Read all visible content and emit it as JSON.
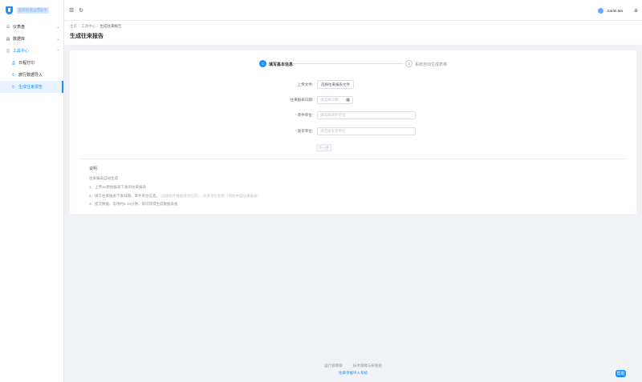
{
  "brand": {
    "name": "医院智能运营助手",
    "accent": "#1890ff"
  },
  "sidebar": {
    "items": [
      {
        "label": "仪表盘",
        "icon": "dashboard-icon"
      },
      {
        "label": "数据库",
        "icon": "database-icon"
      },
      {
        "label": "工具中心",
        "icon": "toolbox-icon",
        "expanded": true
      }
    ],
    "subitems": [
      {
        "label": "日程打印",
        "icon": "print-icon"
      },
      {
        "label": "旅行数据导入",
        "icon": "refresh-icon"
      },
      {
        "label": "生成往来报告",
        "icon": "refresh-icon",
        "active": true
      }
    ]
  },
  "header": {
    "user_name": "Sarah Ma"
  },
  "breadcrumb": {
    "home": "主页",
    "parent": "工具中心",
    "current": "生成往来报告"
  },
  "page_title": "生成往来报告",
  "steps": [
    {
      "num": "1",
      "label": "填写基本信息"
    },
    {
      "num": "2",
      "label": "系统自动生成表格"
    }
  ],
  "form": {
    "upload_label": "上传文件:",
    "upload_button": "选择往来报表文件",
    "date_label": "往来报表日期:",
    "date_placeholder": "请选择日期",
    "sender_label": "寄件单位:",
    "sender_placeholder": "请选择寄件单位",
    "receiver_label": "发货单位:",
    "receiver_placeholder": "请选择发货单位",
    "next_button": "下一步"
  },
  "description": {
    "title": "说明",
    "subtitle": "往来报表自动生成",
    "lines": [
      "1、上传xls原始报表下发的往来报表",
      "2、填写往来报表下发日期、寄件单位信息，",
      "3、提交数据、等待约5-10分钟，即可获得生成数据表格"
    ],
    "line2_extra": "（选择收件数据库对应的）、往来单位名称（例如中国往来报表）"
  },
  "footer": {
    "links": [
      "运行保障部",
      "技术保障与研发组"
    ],
    "copyright": "往来单据导入系统"
  },
  "help_button": "帮助"
}
